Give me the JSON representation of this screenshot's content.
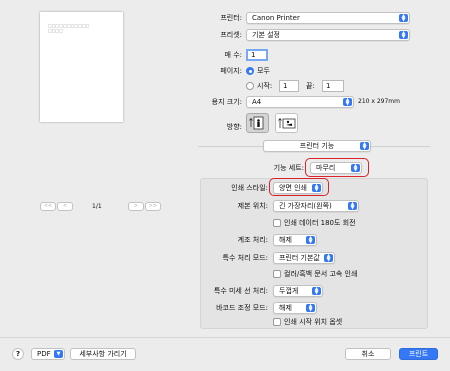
{
  "preview": {
    "page_text_line1": "□□□□□□□□□□□",
    "page_text_line2": "□□□□",
    "nav_first": "<<",
    "nav_prev": "<",
    "page_indicator": "1/1",
    "nav_next": ">",
    "nav_last": ">>"
  },
  "printer": {
    "label": "프린터:",
    "value": "Canon Printer"
  },
  "preset": {
    "label": "프리셋:",
    "value": "기본 설정"
  },
  "copies": {
    "label": "매 수:",
    "value": "1"
  },
  "pages": {
    "label": "페이지:",
    "all_label": "모두",
    "from_label": "시작:",
    "from_value": "1",
    "to_label": "끝:",
    "to_value": "1"
  },
  "paper_size": {
    "label": "용지 크기:",
    "value": "A4",
    "dims": "210 x 297mm"
  },
  "orientation": {
    "label": "방향:"
  },
  "section_popup": {
    "value": "프린터 기능"
  },
  "feature_set": {
    "label": "기능 세트:",
    "value": "마무리"
  },
  "settings": {
    "print_style": {
      "label": "인쇄 스타일:",
      "value": "양면 인쇄"
    },
    "binding": {
      "label": "제본 위치:",
      "value": "긴 가장자리(왼쪽)"
    },
    "rotate_180": {
      "label": "인쇄 데이터 180도 회전"
    },
    "offset": {
      "label": "계조 처리:",
      "value": "해제"
    },
    "special_mode": {
      "label": "특수 처리 모드:",
      "value": "프린터 기본값"
    },
    "color_bw_fast": {
      "label": "컬러/흑백 문서 고속 인쇄"
    },
    "fine_line": {
      "label": "특수 미세 선 처리:",
      "value": "두껍게"
    },
    "barcode": {
      "label": "바코드 조정 모드:",
      "value": "해제"
    },
    "start_position": {
      "label": "인쇄 시작 위치 옵셋"
    }
  },
  "footer": {
    "help": "?",
    "pdf": "PDF",
    "hide_details": "세부사항 가리기",
    "cancel": "취소",
    "print": "프린트"
  },
  "colors": {
    "accent": "#3478f6",
    "highlight": "#d8232a"
  }
}
